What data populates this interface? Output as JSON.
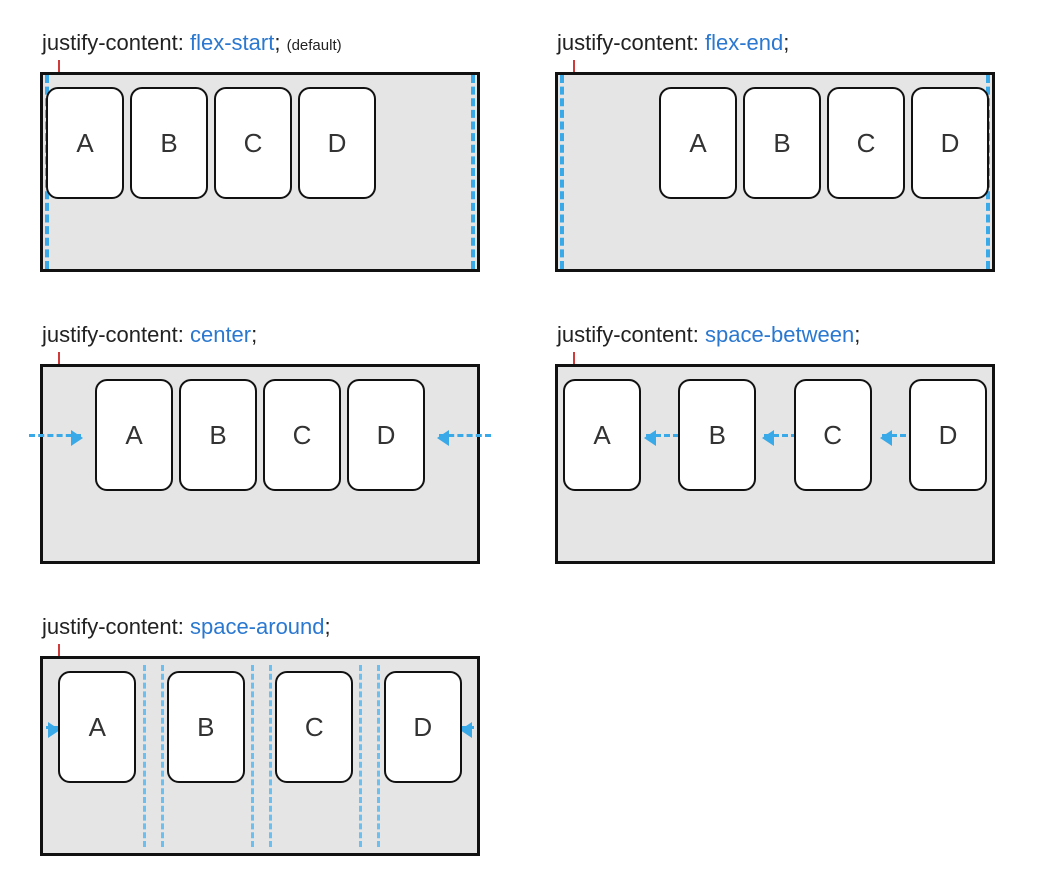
{
  "diagrams": {
    "flex_start": {
      "property": "justify-content:",
      "value": "flex-start",
      "semicolon": ";",
      "suffix": "(default)",
      "items": [
        "A",
        "B",
        "C",
        "D"
      ]
    },
    "flex_end": {
      "property": "justify-content:",
      "value": "flex-end",
      "semicolon": ";",
      "items": [
        "A",
        "B",
        "C",
        "D"
      ]
    },
    "center": {
      "property": "justify-content:",
      "value": "center",
      "semicolon": ";",
      "items": [
        "A",
        "B",
        "C",
        "D"
      ]
    },
    "space_between": {
      "property": "justify-content:",
      "value": "space-between",
      "semicolon": ";",
      "items": [
        "A",
        "B",
        "C",
        "D"
      ]
    },
    "space_around": {
      "property": "justify-content:",
      "value": "space-around",
      "semicolon": ";",
      "items": [
        "A",
        "B",
        "C",
        "D"
      ]
    }
  }
}
